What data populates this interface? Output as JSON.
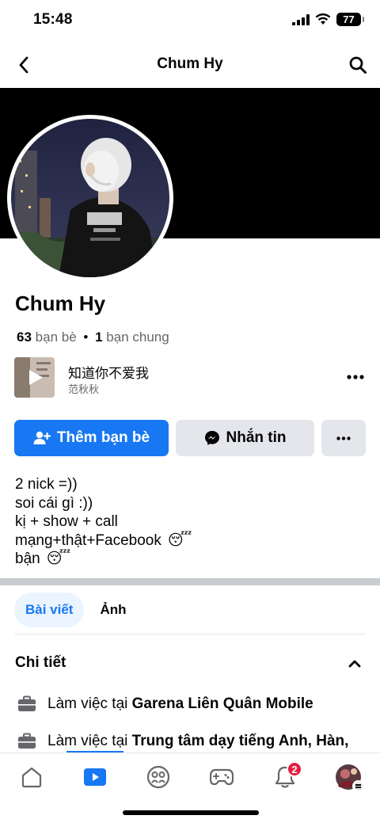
{
  "status": {
    "time": "15:48",
    "battery": "77"
  },
  "nav": {
    "title": "Chum Hy"
  },
  "profile": {
    "name": "Chum Hy",
    "friend_count": "63",
    "friend_label": "bạn bè",
    "separator": "•",
    "mutual_count": "1",
    "mutual_label": "bạn chung"
  },
  "music": {
    "title": "知道你不爱我",
    "artist": "范秋秋"
  },
  "actions": {
    "add_friend": "Thêm bạn bè",
    "message": "Nhắn tin"
  },
  "bio": {
    "line1": "2 nick =))",
    "line2": "soi cái gì :))",
    "line3": "kị + show + call",
    "line4": "mạng+thật+Facebook",
    "line5": "bận",
    "emoji": "😴"
  },
  "tabs": [
    {
      "label": "Bài viết",
      "active": true
    },
    {
      "label": "Ảnh",
      "active": false
    }
  ],
  "details": {
    "title": "Chi tiết",
    "items": [
      {
        "prefix": "Làm việc tại",
        "bold": "Garena Liên Quân Mobile",
        "icon": "briefcase-icon"
      },
      {
        "prefix": "Làm việc tại",
        "bold": "Trung tâm dạy tiếng Anh, Hàn,",
        "icon": "briefcase-icon"
      }
    ]
  },
  "bottom_nav": {
    "items": [
      "home-icon",
      "video-icon",
      "friends-icon",
      "gaming-icon",
      "notifications-icon",
      "profile-avatar"
    ],
    "notification_count": "2"
  },
  "colors": {
    "accent": "#1877f2",
    "badge": "#e41e3f",
    "secondary_button": "#e4e6eb",
    "muted_text": "#65676b"
  }
}
